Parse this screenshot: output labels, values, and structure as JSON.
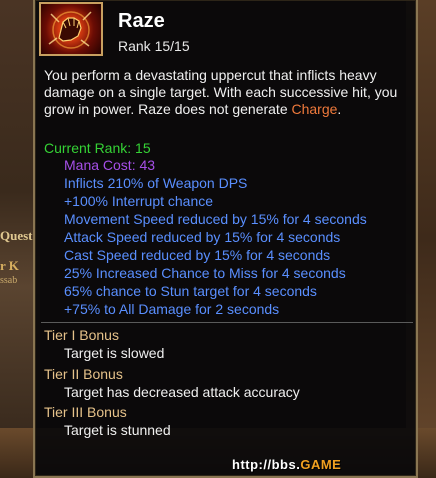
{
  "background": {
    "fragments": [
      "Quest",
      "r K",
      "ssab"
    ]
  },
  "skill": {
    "icon": "raze-fist-icon",
    "name": "Raze",
    "rank": "Rank 15/15",
    "description_before": "You perform a devastating uppercut that inflicts heavy damage on a single target. With each successive hit, you grow in power. Raze does not generate ",
    "description_keyword": "Charge",
    "description_after": "."
  },
  "current": {
    "rank_label": "Current Rank: 15",
    "mana_cost": "Mana Cost: 43",
    "effects": [
      "Inflicts 210% of Weapon DPS",
      "+100% Interrupt chance",
      "Movement Speed reduced by 15% for 4 seconds",
      "Attack Speed reduced by 15% for 4 seconds",
      "Cast Speed reduced by 15% for 4 seconds",
      "25% Increased Chance to Miss for 4 seconds",
      "65% chance to Stun target for 4 seconds",
      "+75% to All Damage for 2 seconds"
    ]
  },
  "tiers": [
    {
      "heading": "Tier I Bonus",
      "detail": "Target is slowed"
    },
    {
      "heading": "Tier II Bonus",
      "detail": "Target has decreased attack accuracy"
    },
    {
      "heading": "Tier III Bonus",
      "detail": "Target is stunned"
    }
  ],
  "watermark": {
    "text": "http://bbs.",
    "suffix": "GAME"
  },
  "colors": {
    "title": "#ffffff",
    "current_rank": "#35d235",
    "mana": "#a64fe8",
    "effects": "#5a8fff",
    "tier_heading": "#e6c28a",
    "charge": "#f07a3c",
    "border": "#8a7652"
  }
}
